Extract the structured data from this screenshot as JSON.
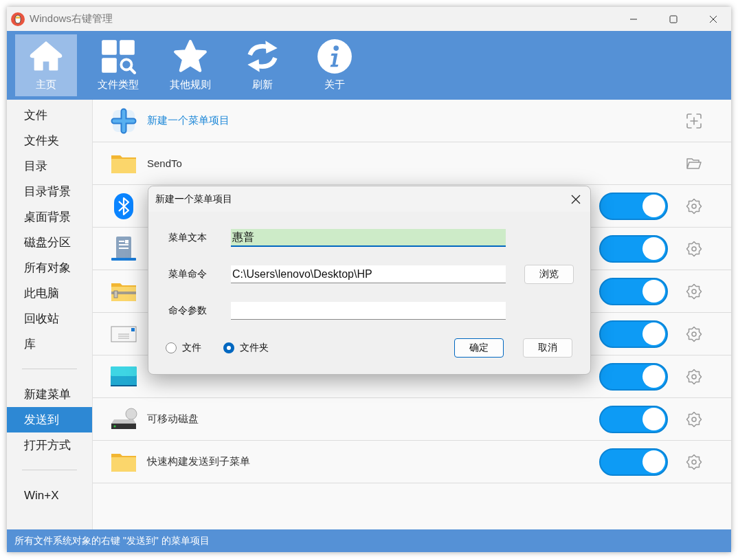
{
  "window": {
    "title": "Windows右键管理"
  },
  "toolbar": {
    "items": [
      {
        "label": "主页",
        "selected": true
      },
      {
        "label": "文件类型",
        "selected": false
      },
      {
        "label": "其他规则",
        "selected": false
      },
      {
        "label": "刷新",
        "selected": false
      },
      {
        "label": "关于",
        "selected": false
      }
    ]
  },
  "sidebar": {
    "groups": [
      {
        "items": [
          {
            "label": "文件",
            "selected": false
          },
          {
            "label": "文件夹",
            "selected": false
          },
          {
            "label": "目录",
            "selected": false
          },
          {
            "label": "目录背景",
            "selected": false
          },
          {
            "label": "桌面背景",
            "selected": false
          },
          {
            "label": "磁盘分区",
            "selected": false
          },
          {
            "label": "所有对象",
            "selected": false
          },
          {
            "label": "此电脑",
            "selected": false
          },
          {
            "label": "回收站",
            "selected": false
          },
          {
            "label": "库",
            "selected": false
          }
        ]
      },
      {
        "items": [
          {
            "label": "新建菜单",
            "selected": false
          },
          {
            "label": "发送到",
            "selected": true
          },
          {
            "label": "打开方式",
            "selected": false
          }
        ]
      },
      {
        "items": [
          {
            "label": "Win+X",
            "selected": false
          }
        ]
      }
    ]
  },
  "rows": [
    {
      "kind": "action",
      "label": "新建一个菜单项目"
    },
    {
      "kind": "link",
      "label": "SendTo"
    },
    {
      "kind": "toggle",
      "on": true
    },
    {
      "kind": "toggle",
      "on": true
    },
    {
      "kind": "toggle",
      "on": true
    },
    {
      "kind": "toggle",
      "on": true
    },
    {
      "kind": "toggle",
      "on": true
    },
    {
      "kind": "toggle",
      "label": "可移动磁盘",
      "on": true
    },
    {
      "kind": "toggle",
      "label": "快速构建发送到子菜单",
      "on": true
    }
  ],
  "dialog": {
    "title": "新建一个菜单项目",
    "fields": [
      {
        "label": "菜单文本",
        "value": "惠普",
        "focused": true
      },
      {
        "label": "菜单命令",
        "value": "C:\\Users\\lenovo\\Desktop\\HP",
        "focused": false,
        "button": "浏览"
      },
      {
        "label": "命令参数",
        "focused": false
      }
    ],
    "radios": [
      {
        "label": "文件",
        "selected": false
      },
      {
        "label": "文件夹",
        "selected": true
      }
    ],
    "buttons": [
      {
        "label": "确定",
        "default": true
      },
      {
        "label": "取消",
        "default": false
      }
    ]
  },
  "status_bar": {
    "text": "所有文件系统对象的右键 \"发送到\" 的菜单项目"
  }
}
